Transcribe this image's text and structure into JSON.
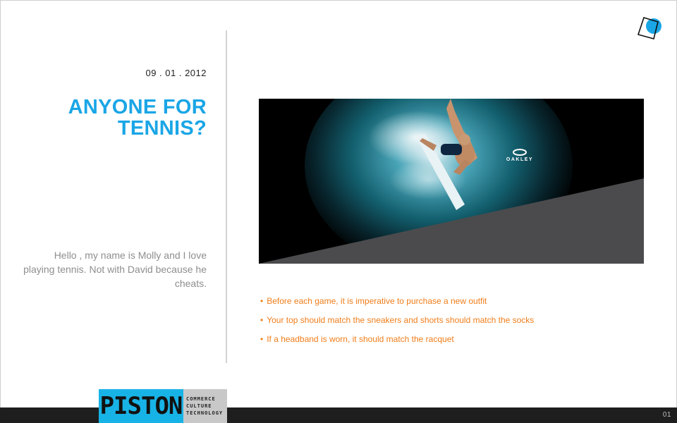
{
  "slide": {
    "date": "09 . 01 . 2012",
    "title_line1": "ANYONE FOR",
    "title_line2": "TENNIS?",
    "intro": "Hello , my name is Molly and I love playing tennis. Not with David because he cheats.",
    "page_number": "01"
  },
  "hero_image": {
    "brand_text": "OAKLEY",
    "icon": "surfer-photo"
  },
  "bullets": [
    "Before each game, it is imperative to purchase a new outfit",
    "Your top should match the sneakers and shorts should match the socks",
    "If a headband is worn, it should match the racquet"
  ],
  "footer": {
    "brand_name": "PISTON",
    "tagline": [
      "COMMERCE",
      "CULTURE",
      "TECHNOLOGY"
    ]
  },
  "colors": {
    "accent_blue": "#1aa6e6",
    "bullet_orange": "#f07d1a",
    "footer_bar": "#1e1e1e",
    "brand_blue": "#18b3e6"
  },
  "icons": {
    "corner_logo": "piston-logo-icon",
    "bullet": "bullet-dot-icon"
  }
}
